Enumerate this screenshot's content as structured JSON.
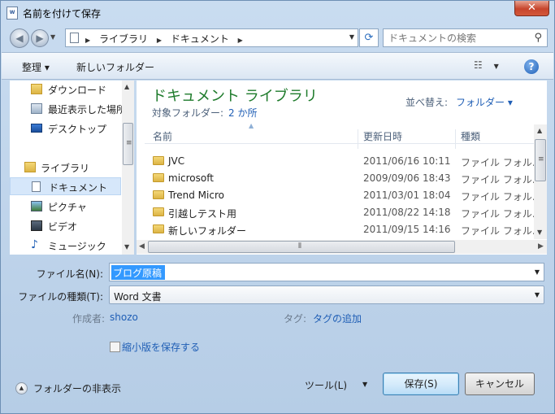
{
  "window": {
    "title": "名前を付けて保存",
    "app_icon_text": "W",
    "close_label": "✕"
  },
  "address": {
    "crumbs": [
      "ライブラリ",
      "ドキュメント"
    ],
    "search_placeholder": "ドキュメントの検索"
  },
  "toolbar": {
    "organize_label": "整理 ▾",
    "new_folder_label": "新しいフォルダー",
    "help_label": "?"
  },
  "nav": {
    "items": [
      {
        "label": "ダウンロード",
        "icon": "download-folder-icon"
      },
      {
        "label": "最近表示した場所",
        "icon": "recent-places-icon"
      },
      {
        "label": "デスクトップ",
        "icon": "desktop-icon"
      },
      {
        "label": "ライブラリ",
        "icon": "library-icon"
      },
      {
        "label": "ドキュメント",
        "icon": "document-icon",
        "selected": true
      },
      {
        "label": "ピクチャ",
        "icon": "picture-icon"
      },
      {
        "label": "ビデオ",
        "icon": "video-icon"
      },
      {
        "label": "ミュージック",
        "icon": "music-icon"
      }
    ]
  },
  "content": {
    "library_title": "ドキュメント ライブラリ",
    "target_label": "対象フォルダー:",
    "target_link": "2 か所",
    "arrange_label": "並べ替え:",
    "arrange_value": "フォルダー ▾",
    "columns": [
      "名前",
      "更新日時",
      "種類"
    ],
    "files": [
      {
        "name": "JVC",
        "date": "2011/06/16 10:11",
        "type": "ファイル フォル..."
      },
      {
        "name": "microsoft",
        "date": "2009/09/06 18:43",
        "type": "ファイル フォル..."
      },
      {
        "name": "Trend Micro",
        "date": "2011/03/01 18:04",
        "type": "ファイル フォル..."
      },
      {
        "name": "引越しテスト用",
        "date": "2011/08/22 14:18",
        "type": "ファイル フォル..."
      },
      {
        "name": "新しいフォルダー",
        "date": "2011/09/15 14:16",
        "type": "ファイル フォル..."
      }
    ]
  },
  "form": {
    "filename_label": "ファイル名(N):",
    "filename_value": "ブログ原稿",
    "filetype_label": "ファイルの種類(T):",
    "filetype_value": "Word 文書",
    "author_label": "作成者:",
    "author_value": "shozo",
    "tags_label": "タグ:",
    "tags_value": "タグの追加",
    "thumbnail_label": "縮小版を保存する",
    "thumbnail_checked": false
  },
  "footer": {
    "hide_folders_label": "フォルダーの非表示",
    "tools_label": "ツール(L)",
    "save_label": "保存(S)",
    "cancel_label": "キャンセル"
  }
}
